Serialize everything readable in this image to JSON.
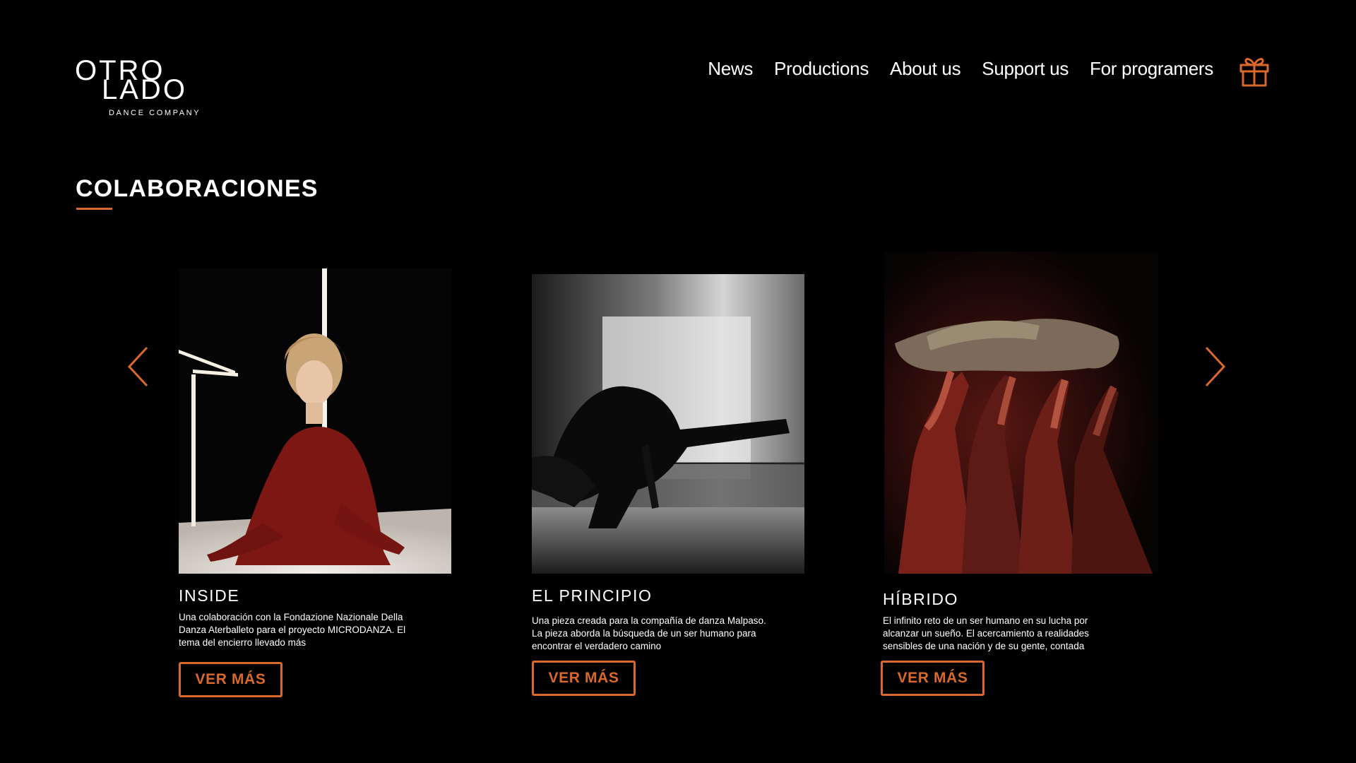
{
  "brand": {
    "logo_top": "OTRO",
    "logo_bottom": "LADO",
    "logo_sub": "DANCE COMPANY"
  },
  "nav": {
    "items": [
      {
        "label": "News"
      },
      {
        "label": "Productions"
      },
      {
        "label": "About us"
      },
      {
        "label": "Support us"
      },
      {
        "label": "For programers"
      }
    ],
    "gift_icon": "gift-icon"
  },
  "section": {
    "title": "COLABORACIONES"
  },
  "carousel": {
    "prev_icon": "chevron-left-icon",
    "next_icon": "chevron-right-icon",
    "cards": [
      {
        "title": "INSIDE",
        "description": "Una colaboración con la Fondazione Nazionale Della Danza Aterballeto para el proyecto MICRODANZA. El tema del encierro llevado más",
        "button": "VER MÁS"
      },
      {
        "title": "EL PRINCIPIO",
        "description": "Una pieza creada para la compañía de danza Malpaso. La pieza aborda la búsqueda de un ser humano para encontrar el verdadero camino",
        "button": "VER MÁS"
      },
      {
        "title": "HÍBRIDO",
        "description": "El infinito reto de un ser humano en su lucha por alcanzar un sueño. El acercamiento a realidades sensibles de una nación y de su gente, contada",
        "button": "VER MÁS"
      }
    ]
  },
  "colors": {
    "accent": "#d9692a",
    "background": "#000000",
    "text": "#ffffff"
  }
}
